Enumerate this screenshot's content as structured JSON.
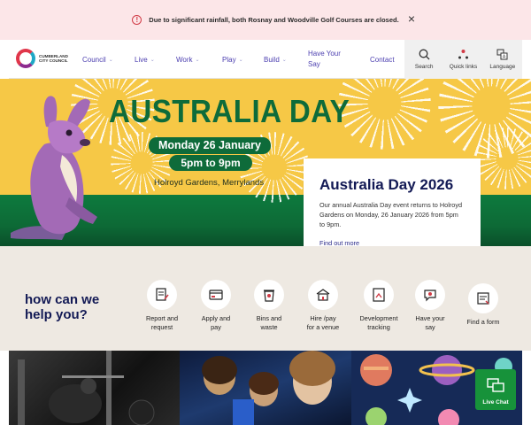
{
  "alert": {
    "message": "Due to significant rainfall, both Rosnay and Woodville Golf Courses are closed.",
    "close_label": "×",
    "icon": "exclamation-circle-icon",
    "color": "#d13b46"
  },
  "header": {
    "logo_text": "CUMBERLAND CITY COUNCIL",
    "nav": [
      {
        "label": "Council",
        "has_dropdown": true
      },
      {
        "label": "Live",
        "has_dropdown": true
      },
      {
        "label": "Work",
        "has_dropdown": true
      },
      {
        "label": "Play",
        "has_dropdown": true
      },
      {
        "label": "Build",
        "has_dropdown": true
      },
      {
        "label": "Have Your Say",
        "has_dropdown": false
      },
      {
        "label": "Contact",
        "has_dropdown": false
      }
    ],
    "tools": [
      {
        "label": "Search",
        "icon": "search-icon"
      },
      {
        "label": "Quick links",
        "icon": "quick-links-icon"
      },
      {
        "label": "Language",
        "icon": "language-icon"
      }
    ],
    "accent_color": "#4c3fb0"
  },
  "hero": {
    "title": "AUSTRALIA DAY",
    "date": "Monday 26 January",
    "time": "5pm to 9pm",
    "venue": "Holroyd Gardens, Merrylands",
    "card": {
      "title": "Australia Day 2026",
      "body": "Our annual Australia Day event returns to Holroyd Gardens on Monday, 26 January 2026 from 5pm to 9pm.",
      "link": "Find out more"
    },
    "bg_color": "#f6c846",
    "green_color": "#0e6b3a"
  },
  "help": {
    "heading_line1": "how can we",
    "heading_line2": "help you?",
    "items": [
      {
        "line1": "Report and",
        "line2": "request",
        "icon": "report-icon"
      },
      {
        "line1": "Apply and",
        "line2": "pay",
        "icon": "apply-pay-icon"
      },
      {
        "line1": "Bins and",
        "line2": "waste",
        "icon": "bin-icon"
      },
      {
        "line1": "Hire /pay",
        "line2": "for a venue",
        "icon": "venue-icon"
      },
      {
        "line1": "Development",
        "line2": "tracking",
        "icon": "development-icon"
      },
      {
        "line1": "Have your",
        "line2": "say",
        "icon": "say-icon"
      },
      {
        "line1": "Find a form",
        "line2": "",
        "icon": "form-icon"
      }
    ]
  },
  "chat": {
    "label": "Live Chat",
    "icon": "chat-icon",
    "color": "#17923a"
  }
}
